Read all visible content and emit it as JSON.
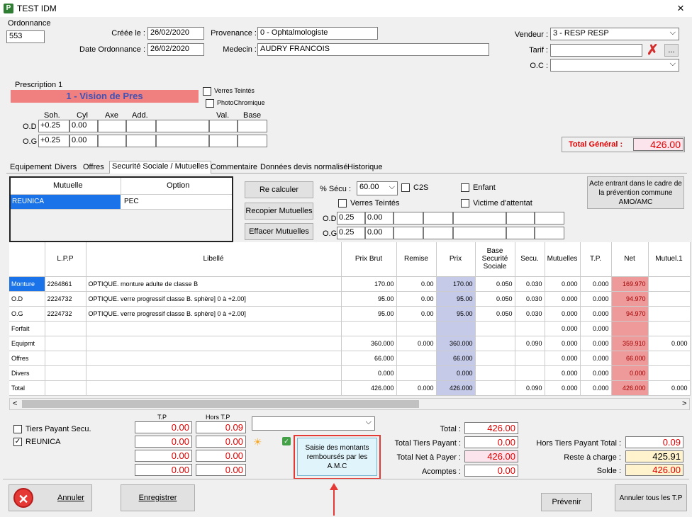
{
  "window": {
    "title": "TEST IDM",
    "close": "×"
  },
  "header": {
    "ordonnance_label": "Ordonnance",
    "ordonnance_value": "553",
    "creee_label": "Créée le :",
    "creee_value": "26/02/2020",
    "date_ord_label": "Date Ordonnance :",
    "date_ord_value": "26/02/2020",
    "provenance_label": "Provenance :",
    "provenance_value": "0 - Ophtalmologiste",
    "medecin_label": "Medecin :",
    "medecin_value": "AUDRY FRANCOIS",
    "vendeur_label": "Vendeur :",
    "vendeur_value": "3 - RESP RESP",
    "tarif_label": "Tarif :",
    "tarif_value": "",
    "tarif_more": "...",
    "oc_label": "O.C :",
    "oc_value": ""
  },
  "prescription": {
    "title": "Prescription 1",
    "vision": "1 - Vision de Pres",
    "verres_teintes": "Verres Teintés",
    "photochromique": "PhotoChromique",
    "cols": [
      "Soh.",
      "Cyl",
      "Axe",
      "Add.",
      "Val.",
      "Base"
    ],
    "od_label": "O.D",
    "od_soh": "+0.25",
    "od_cyl": "0.00",
    "og_label": "O.G",
    "og_soh": "+0.25",
    "og_cyl": "0.00"
  },
  "total_general": {
    "label": "Total Général :",
    "value": "426.00"
  },
  "tabs": [
    "Equipement",
    "Divers",
    "Offres",
    "Securité Sociale / Mutuelles",
    "Commentaire",
    "Données devis normalisé",
    "Historique"
  ],
  "mutuelle": {
    "col_mutuelle": "Mutuelle",
    "col_option": "Option",
    "row_mutuelle": "REUNICA",
    "row_option": "PEC",
    "recalc": "Re calculer",
    "recopier": "Recopier Mutuelles",
    "efface": "Effacer Mutuelles",
    "pct_secu_label": "% Sécu :",
    "pct_secu_value": "60.00",
    "c2s": "C2S",
    "enfant": "Enfant",
    "verres_teintes": "Verres Teintés",
    "victime": "Victime d'attentat",
    "od_label": "O.D",
    "od_v1": "0.25",
    "od_v2": "0.00",
    "og_label": "O.G",
    "og_v1": "0.25",
    "og_v2": "0.00",
    "acte": "Acte entrant dans le cadre de la prévention commune AMO/AMC"
  },
  "grid": {
    "headers": [
      "",
      "L.P.P",
      "Libellé",
      "Prix Brut",
      "Remise",
      "Prix",
      "Base Securité Sociale",
      "Secu.",
      "Mutuelles",
      "T.P.",
      "Net",
      "Mutuel.1"
    ],
    "rows": [
      {
        "label": "Monture",
        "lpp": "2264861",
        "lib": "OPTIQUE. monture adulte de classe B",
        "brut": "170.00",
        "remise": "0.00",
        "prix": "170.00",
        "base": "0.050",
        "secu": "0.030",
        "mut": "0.000",
        "tp": "0.000",
        "net": "169.970",
        "mut1": ""
      },
      {
        "label": "O.D",
        "lpp": "2224732",
        "lib": "OPTIQUE. verre progressif classe B. sphère] 0 à +2.00]",
        "brut": "95.00",
        "remise": "0.00",
        "prix": "95.00",
        "base": "0.050",
        "secu": "0.030",
        "mut": "0.000",
        "tp": "0.000",
        "net": "94.970",
        "mut1": ""
      },
      {
        "label": "O.G",
        "lpp": "2224732",
        "lib": "OPTIQUE. verre progressif classe B. sphère] 0 à +2.00]",
        "brut": "95.00",
        "remise": "0.00",
        "prix": "95.00",
        "base": "0.050",
        "secu": "0.030",
        "mut": "0.000",
        "tp": "0.000",
        "net": "94.970",
        "mut1": ""
      },
      {
        "label": "Forfait",
        "lpp": "",
        "lib": "",
        "brut": "",
        "remise": "",
        "prix": "",
        "base": "",
        "secu": "",
        "mut": "0.000",
        "tp": "0.000",
        "net": "",
        "mut1": ""
      },
      {
        "label": "Equipmt",
        "lpp": "",
        "lib": "",
        "brut": "360.000",
        "remise": "0.000",
        "prix": "360.000",
        "base": "",
        "secu": "0.090",
        "mut": "0.000",
        "tp": "0.000",
        "net": "359.910",
        "mut1": "0.000"
      },
      {
        "label": "Offres",
        "lpp": "",
        "lib": "",
        "brut": "66.000",
        "remise": "",
        "prix": "66.000",
        "base": "",
        "secu": "",
        "mut": "0.000",
        "tp": "0.000",
        "net": "66.000",
        "mut1": ""
      },
      {
        "label": "Divers",
        "lpp": "",
        "lib": "",
        "brut": "0.000",
        "remise": "",
        "prix": "0.000",
        "base": "",
        "secu": "",
        "mut": "0.000",
        "tp": "0.000",
        "net": "0.000",
        "mut1": ""
      },
      {
        "label": "Total",
        "lpp": "",
        "lib": "",
        "brut": "426.000",
        "remise": "0.000",
        "prix": "426.000",
        "base": "",
        "secu": "0.090",
        "mut": "0.000",
        "tp": "0.000",
        "net": "426.000",
        "mut1": "0.000"
      }
    ]
  },
  "bottom": {
    "tiers_payant_secu": "Tiers Payant Secu.",
    "reunica": "REUNICA",
    "tp_label": "T.P",
    "hors_tp_label": "Hors T.P",
    "tp_values": [
      "0.00",
      "0.00",
      "0.00",
      "0.00"
    ],
    "hors_tp_values": [
      "0.09",
      "0.00",
      "0.00",
      "0.00"
    ],
    "saisie": "Saisie des montants remboursés par les A.M.C",
    "total_label": "Total :",
    "total_value": "426.00",
    "total_tp_label": "Total Tiers Payant :",
    "total_tp_value": "0.00",
    "total_net_label": "Total Net à Payer :",
    "total_net_value": "426.00",
    "acomptes_label": "Acomptes :",
    "acomptes_value": "0.00",
    "hors_tp_total_label": "Hors Tiers Payant Total :",
    "hors_tp_total_value": "0.09",
    "reste_label": "Reste à charge :",
    "reste_value": "425.91",
    "solde_label": "Solde :",
    "solde_value": "426.00"
  },
  "footer": {
    "annuler": "Annuler",
    "enregistrer": "Enregistrer",
    "prevenir": "Prévenir",
    "annuler_tp": "Annuler tous les T.P"
  }
}
